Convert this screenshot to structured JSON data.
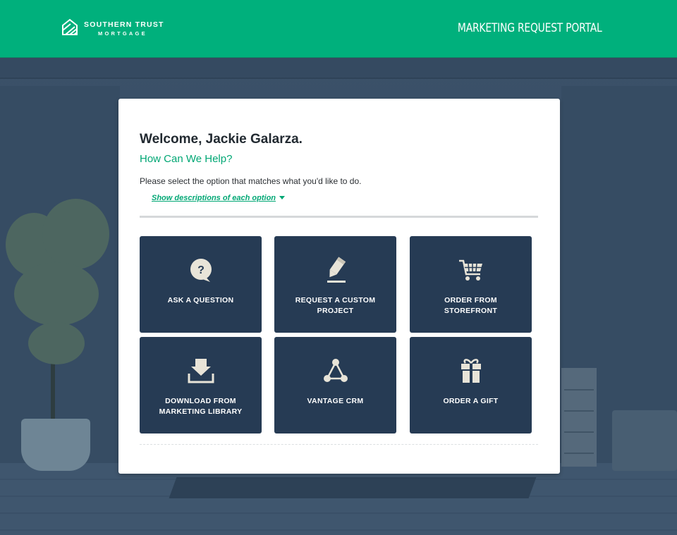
{
  "header": {
    "brand_line1": "SOUTHERN TRUST",
    "brand_line2": "MORTGAGE",
    "portal_title": "MARKETING REQUEST PORTAL"
  },
  "card": {
    "welcome": "Welcome, Jackie Galarza.",
    "subtitle": "How Can We Help?",
    "instruction": "Please select the option that matches what you'd like to do.",
    "show_descriptions": "Show descriptions of each option"
  },
  "options": [
    {
      "label": "ASK A QUESTION",
      "icon": "question-bubble-icon"
    },
    {
      "label": "REQUEST A CUSTOM PROJECT",
      "icon": "pencil-icon"
    },
    {
      "label": "ORDER FROM STOREFRONT",
      "icon": "shopping-cart-icon"
    },
    {
      "label": "DOWNLOAD FROM MARKETING LIBRARY",
      "icon": "download-tray-icon"
    },
    {
      "label": "VANTAGE CRM",
      "icon": "network-nodes-icon"
    },
    {
      "label": "ORDER A GIFT",
      "icon": "gift-icon"
    }
  ],
  "colors": {
    "brand_green": "#00b07c",
    "tile_navy": "#263b54",
    "icon_beige": "#e8e4d8",
    "link_green": "#00a774"
  }
}
